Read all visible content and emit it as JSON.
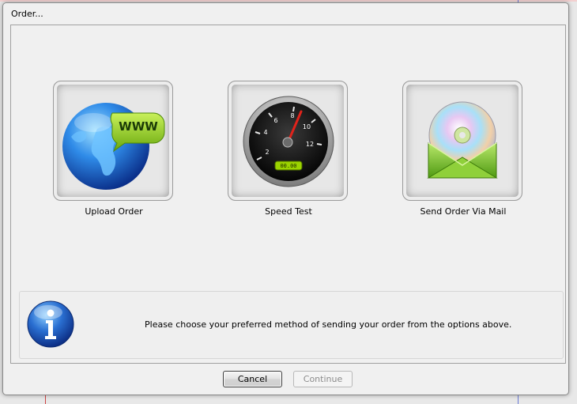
{
  "window": {
    "title": "Order..."
  },
  "options": [
    {
      "label": "Upload Order",
      "icon": "globe-www-icon"
    },
    {
      "label": "Speed Test",
      "icon": "speedometer-icon"
    },
    {
      "label": "Send Order Via Mail",
      "icon": "cd-envelope-icon"
    }
  ],
  "globe": {
    "badge": "WWW"
  },
  "speedometer": {
    "ticks": [
      "2",
      "4",
      "6",
      "8",
      "10",
      "12"
    ],
    "readout": "00.00"
  },
  "info": {
    "icon": "info-icon",
    "message": "Please choose your preferred method of sending your order from the options above."
  },
  "buttons": {
    "cancel": "Cancel",
    "continue": "Continue"
  },
  "colors": {
    "accent": "#2a6fd1",
    "dialog_bg": "#f0f0f0",
    "gauge_readout": "#9bd300"
  }
}
